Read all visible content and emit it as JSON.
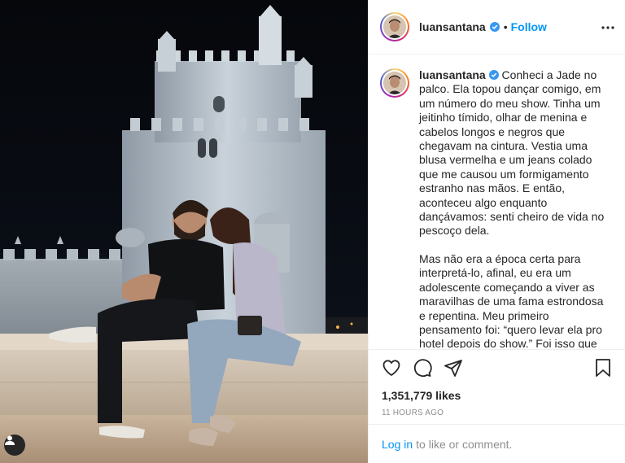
{
  "post": {
    "username": "luansantana",
    "follow_label": "Follow",
    "dot": "•",
    "caption_paragraphs": [
      "Conheci a Jade no palco. Ela topou dançar comigo, em um número do meu show. Tinha um jeitinho tímido, olhar de menina e cabelos longos e negros que chegavam na cintura. Vestia uma blusa vermelha e um jeans colado que me causou um formigamento estranho nas mãos. E então, aconteceu algo enquanto dançávamos: senti cheiro de vida no pescoço dela.",
      "Mas não era a época certa para interpretá-lo, afinal, eu era um adolescente começando a viver as maravilhas de uma fama estrondosa e repentina. Meu primeiro pensamento foi: “quero levar ela pro hotel depois do show.” Foi isso que"
    ],
    "likes": "1,351,779 likes",
    "timestamp": "11 HOURS AGO",
    "login_link": "Log in",
    "login_suffix": "to like or comment."
  },
  "icons": {
    "verified": "verified-badge-icon",
    "more": "more-options-icon",
    "like": "heart-icon",
    "comment": "comment-icon",
    "share": "share-icon",
    "save": "bookmark-icon",
    "user_tags": "user-tag-icon"
  },
  "colors": {
    "link_blue": "#0095f6",
    "text": "#262626",
    "muted": "#8e8e8e",
    "border": "#efefef"
  }
}
